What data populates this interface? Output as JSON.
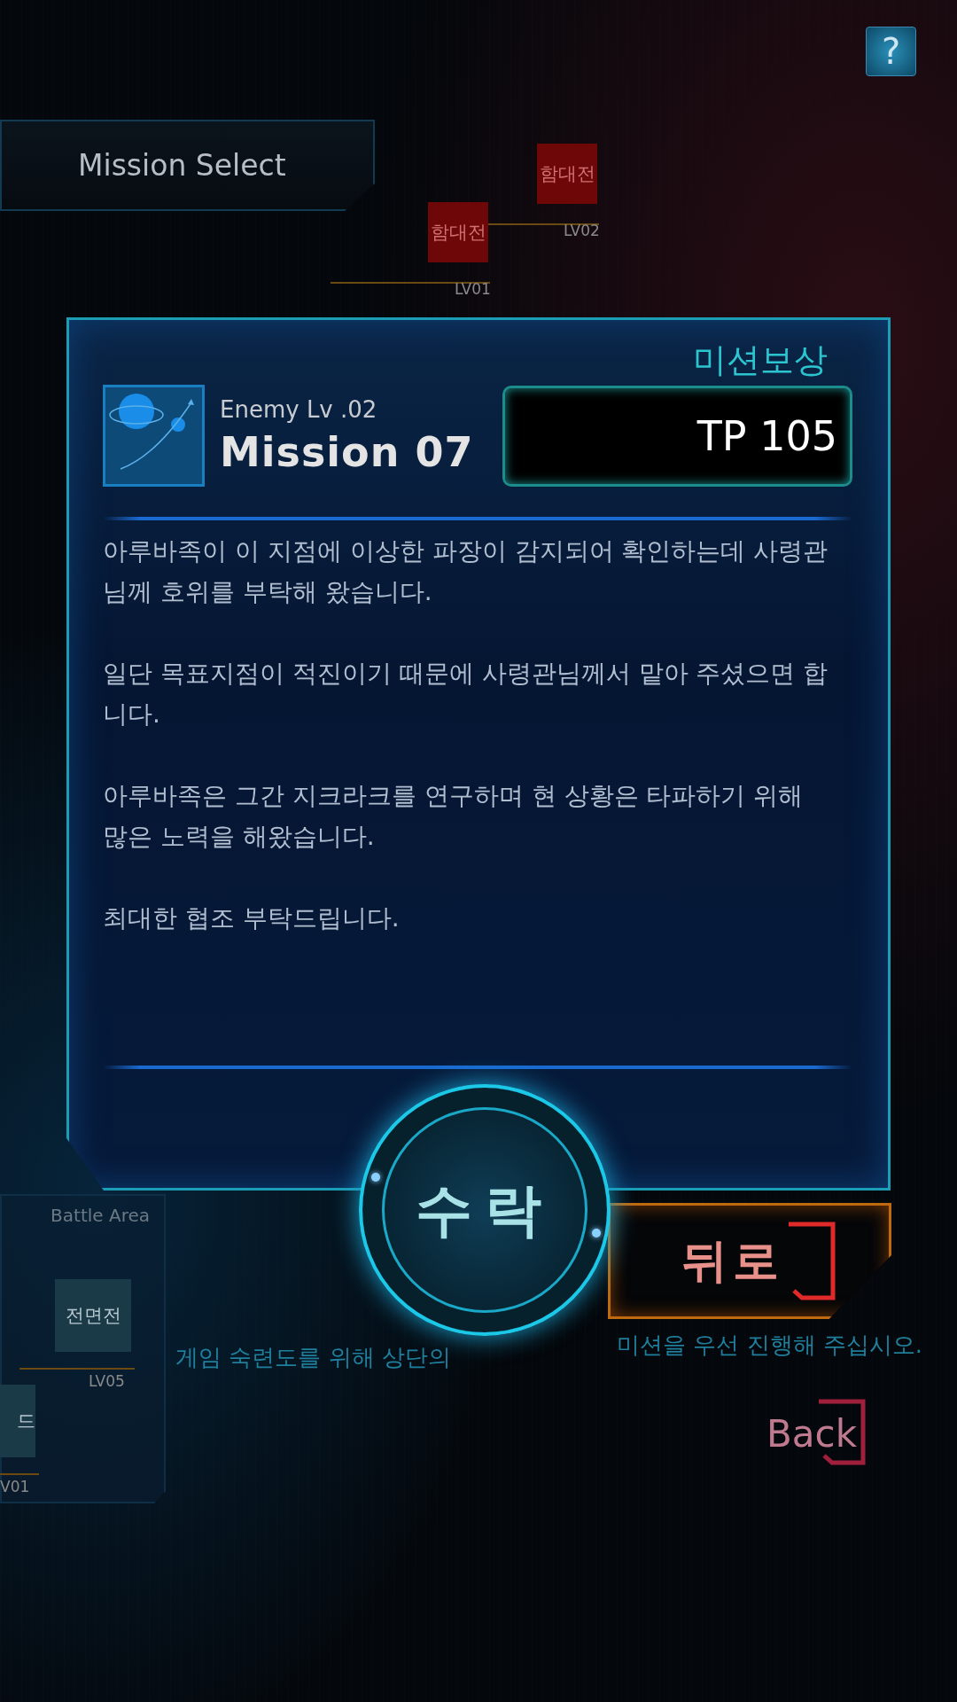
{
  "help_button": {
    "label": "?"
  },
  "header": {
    "title": "Mission Select"
  },
  "map_nodes": [
    {
      "label": "함대전",
      "level_label": "LV02",
      "kind": "fleet"
    },
    {
      "label": "함대전",
      "level_label": "LV01",
      "kind": "fleet"
    }
  ],
  "battle_area": {
    "title": "Battle Area",
    "nodes": [
      {
        "label": "전면전",
        "level_label": "LV05",
        "kind": "battle"
      },
      {
        "label": "드",
        "level_label": "V01",
        "kind": "battle"
      }
    ]
  },
  "mission": {
    "enemy_level": "Enemy Lv .02",
    "title": "Mission 07",
    "reward_label": "미션보상",
    "reward": "TP 105",
    "paragraphs": [
      "아루바족이 이 지점에 이상한 파장이 감지되어 확인하는데 사령관님께 호위를 부탁해 왔습니다.",
      "일단 목표지점이 적진이기 때문에 사령관님께서 맡아 주셨으면 합니다.",
      "아루바족은 그간 지크라크를 연구하며 현 상황은 타파하기 위해 많은 노력을 해왔습니다.",
      "최대한 협조 부탁드립니다."
    ]
  },
  "accept_button": {
    "label": "수락"
  },
  "return_button": {
    "label": "뒤로"
  },
  "hint_parts": [
    "게임 숙련도를 위해 상단의",
    "미션을 우선 진행해 주십시오."
  ],
  "back_button": {
    "label": "Back"
  }
}
